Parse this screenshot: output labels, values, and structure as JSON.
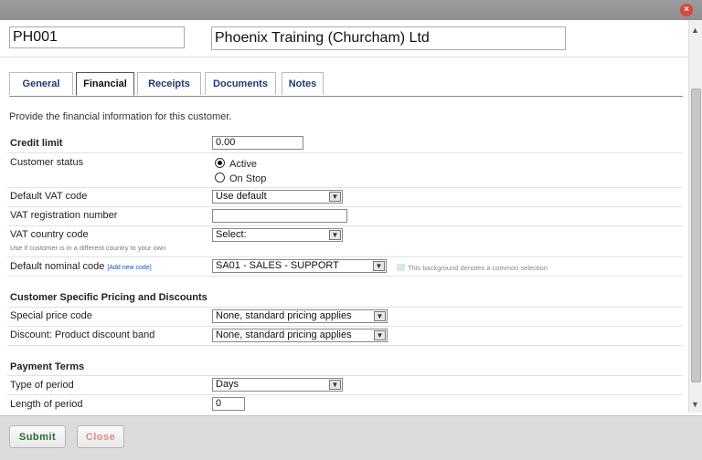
{
  "window": {
    "close_glyph": "×"
  },
  "customer": {
    "code": "PH001",
    "name": "Phoenix Training (Churcham) Ltd"
  },
  "tabs": [
    {
      "label": "General"
    },
    {
      "label": "Financial"
    },
    {
      "label": "Receipts"
    },
    {
      "label": "Documents"
    },
    {
      "label": "Notes"
    }
  ],
  "intro": "Provide the financial information for this customer.",
  "fields": {
    "credit_limit": {
      "label": "Credit limit",
      "value": "0.00"
    },
    "customer_status": {
      "label": "Customer status",
      "options": [
        "Active",
        "On Stop"
      ],
      "selected": "Active"
    },
    "default_vat_code": {
      "label": "Default VAT code",
      "value": "Use default"
    },
    "vat_registration": {
      "label": "VAT registration number",
      "value": ""
    },
    "vat_country": {
      "label": "VAT country code",
      "hint": "Use if customer is in a different country to your own",
      "value": "Select:"
    },
    "default_nominal": {
      "label": "Default nominal code",
      "add_link": "[Add new code]",
      "value": "SA01 - SALES - SUPPORT",
      "common_hint": "This background denotes a common selection"
    }
  },
  "pricing": {
    "title": "Customer Specific Pricing and Discounts",
    "special_price": {
      "label": "Special price code",
      "value": "None, standard pricing applies"
    },
    "discount_band": {
      "label": "Discount: Product discount band",
      "value": "None, standard pricing applies"
    }
  },
  "payment": {
    "title": "Payment Terms",
    "type_of_period": {
      "label": "Type of period",
      "value": "Days"
    },
    "length_of_period": {
      "label": "Length of period",
      "value": "0"
    }
  },
  "footer": {
    "submit": "Submit",
    "close": "Close"
  },
  "colors": {
    "tab_text": "#1f3a6e",
    "close_button_text": "#e08a8a",
    "submit_text": "#1f6e3a",
    "common_bg": "#d6ecd6"
  }
}
